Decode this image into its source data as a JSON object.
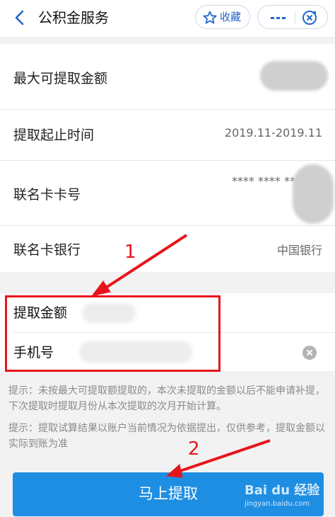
{
  "header": {
    "title": "公积金服务",
    "favorite_label": "收藏"
  },
  "info_rows": [
    {
      "label": "最大可提取金额",
      "value": ""
    },
    {
      "label": "提取起止时间",
      "value": "2019.11-2019.11"
    },
    {
      "label": "联名卡卡号",
      "value": "**** **** ***"
    },
    {
      "label": "联名卡银行",
      "value": "中国银行"
    }
  ],
  "form": {
    "amount_label": "提取金额",
    "phone_label": "手机号"
  },
  "notes": [
    "提示：未按最大可提取额提取的，本次未提取的金额以后不能申请补提，下次提取时提取月份从本次提取的次月开始计算。",
    "提示：提取试算结果以账户当前情况为依据提出，仅供参考，提取金额以实际到账为准"
  ],
  "submit_label": "马上提取",
  "annotations": {
    "step1": "1",
    "step2": "2"
  },
  "watermark": {
    "text": "Bai du 经验",
    "sub": "jingyan.baidu.com"
  },
  "colors": {
    "accent": "#1e8ee3",
    "annotation": "#e8141b"
  }
}
